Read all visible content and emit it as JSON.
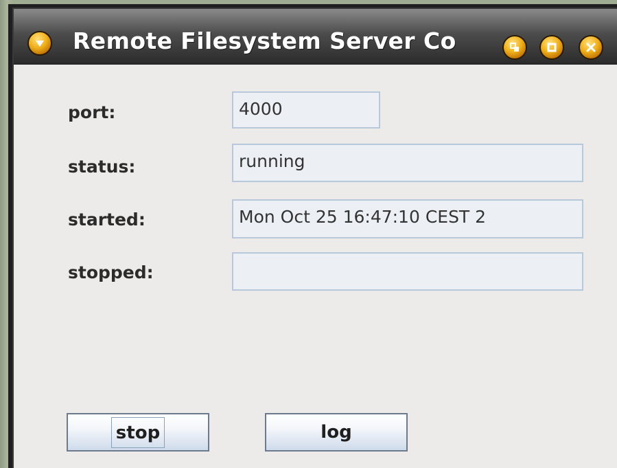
{
  "window": {
    "title": "Remote Filesystem Server Co"
  },
  "form": {
    "port": {
      "label": "port:",
      "value": "4000"
    },
    "status": {
      "label": "status:",
      "value": "running"
    },
    "started": {
      "label": "started:",
      "value": "Mon Oct 25 16:47:10 CEST 2"
    },
    "stopped": {
      "label": "stopped:",
      "value": ""
    }
  },
  "buttons": {
    "stop": "stop",
    "log": "log"
  },
  "colors": {
    "title_button_accent": "#f0b01c",
    "field_border": "#b6c8da",
    "window_bg": "#ecebea"
  },
  "icons": {
    "menu": "chevron-down-icon",
    "resize": "restore-icon",
    "maximize": "maximize-icon",
    "close": "close-icon"
  }
}
